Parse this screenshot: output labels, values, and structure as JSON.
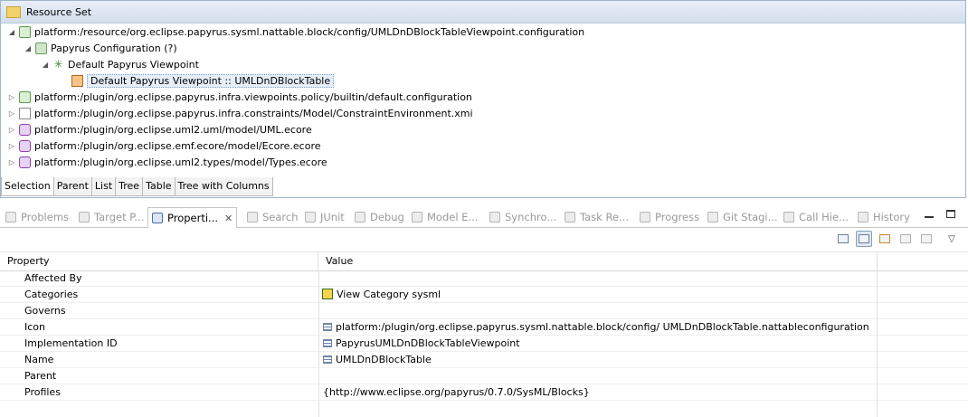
{
  "resource_set": {
    "title": "Resource Set",
    "tree": [
      {
        "label": "platform:/resource/org.eclipse.papyrus.sysml.nattable.block/config/UMLDnDBlockTableViewpoint.configuration",
        "icon": "resource-config-icon",
        "expanded": true
      },
      {
        "label": "Papyrus Configuration (?)",
        "icon": "papyrus-configuration-icon",
        "expanded": true
      },
      {
        "label": "Default Papyrus Viewpoint",
        "icon": "viewpoint-icon",
        "expanded": true
      },
      {
        "label": "Default Papyrus Viewpoint :: UMLDnDBlockTable",
        "icon": "table-icon",
        "selected": true
      },
      {
        "label": "platform:/plugin/org.eclipse.papyrus.infra.viewpoints.policy/builtin/default.configuration",
        "icon": "resource-config-icon",
        "expanded": false
      },
      {
        "label": "platform:/plugin/org.eclipse.papyrus.infra.constraints/Model/ConstraintEnvironment.xmi",
        "icon": "document-icon",
        "expanded": false
      },
      {
        "label": "platform:/plugin/org.eclipse.uml2.uml/model/UML.ecore",
        "icon": "ecore-package-icon",
        "expanded": false
      },
      {
        "label": "platform:/plugin/org.eclipse.emf.ecore/model/Ecore.ecore",
        "icon": "ecore-package-icon",
        "expanded": false
      },
      {
        "label": "platform:/plugin/org.eclipse.uml2.types/model/Types.ecore",
        "icon": "ecore-package-icon",
        "expanded": false
      }
    ],
    "tabs": [
      "Selection",
      "Parent",
      "List",
      "Tree",
      "Table",
      "Tree with Columns"
    ],
    "active_tab": "Selection"
  },
  "views": {
    "tabs": [
      {
        "label": "Problems",
        "icon": "problems-icon"
      },
      {
        "label": "Target P...",
        "icon": "target-platform-icon"
      },
      {
        "label": "Properti...",
        "icon": "properties-icon",
        "active": true
      },
      {
        "label": "Search",
        "icon": "search-icon"
      },
      {
        "label": "JUnit",
        "icon": "junit-icon"
      },
      {
        "label": "Debug",
        "icon": "debug-icon"
      },
      {
        "label": "Model E...",
        "icon": "model-explorer-icon"
      },
      {
        "label": "Synchro...",
        "icon": "synchronize-icon"
      },
      {
        "label": "Task Re...",
        "icon": "task-repositories-icon"
      },
      {
        "label": "Progress",
        "icon": "progress-icon"
      },
      {
        "label": "Git Stagi...",
        "icon": "git-staging-icon"
      },
      {
        "label": "Call Hie...",
        "icon": "call-hierarchy-icon"
      },
      {
        "label": "History",
        "icon": "history-icon"
      }
    ]
  },
  "properties": {
    "columns": [
      "Property",
      "Value"
    ],
    "rows": [
      {
        "property": "Affected By",
        "value": ""
      },
      {
        "property": "Categories",
        "value": "View Category sysml",
        "icon": "category-icon"
      },
      {
        "property": "Governs",
        "value": ""
      },
      {
        "property": "Icon",
        "value": "platform:/plugin/org.eclipse.papyrus.sysml.nattable.block/config/ UMLDnDBlockTable.nattableconfiguration",
        "icon": "text-value-icon"
      },
      {
        "property": "Implementation ID",
        "value": "PapyrusUMLDnDBlockTableViewpoint",
        "icon": "text-value-icon"
      },
      {
        "property": "Name",
        "value": "UMLDnDBlockTable",
        "icon": "text-value-icon"
      },
      {
        "property": "Parent",
        "value": ""
      },
      {
        "property": "Profiles",
        "value": "{http://www.eclipse.org/papyrus/0.7.0/SysML/Blocks}"
      }
    ]
  }
}
